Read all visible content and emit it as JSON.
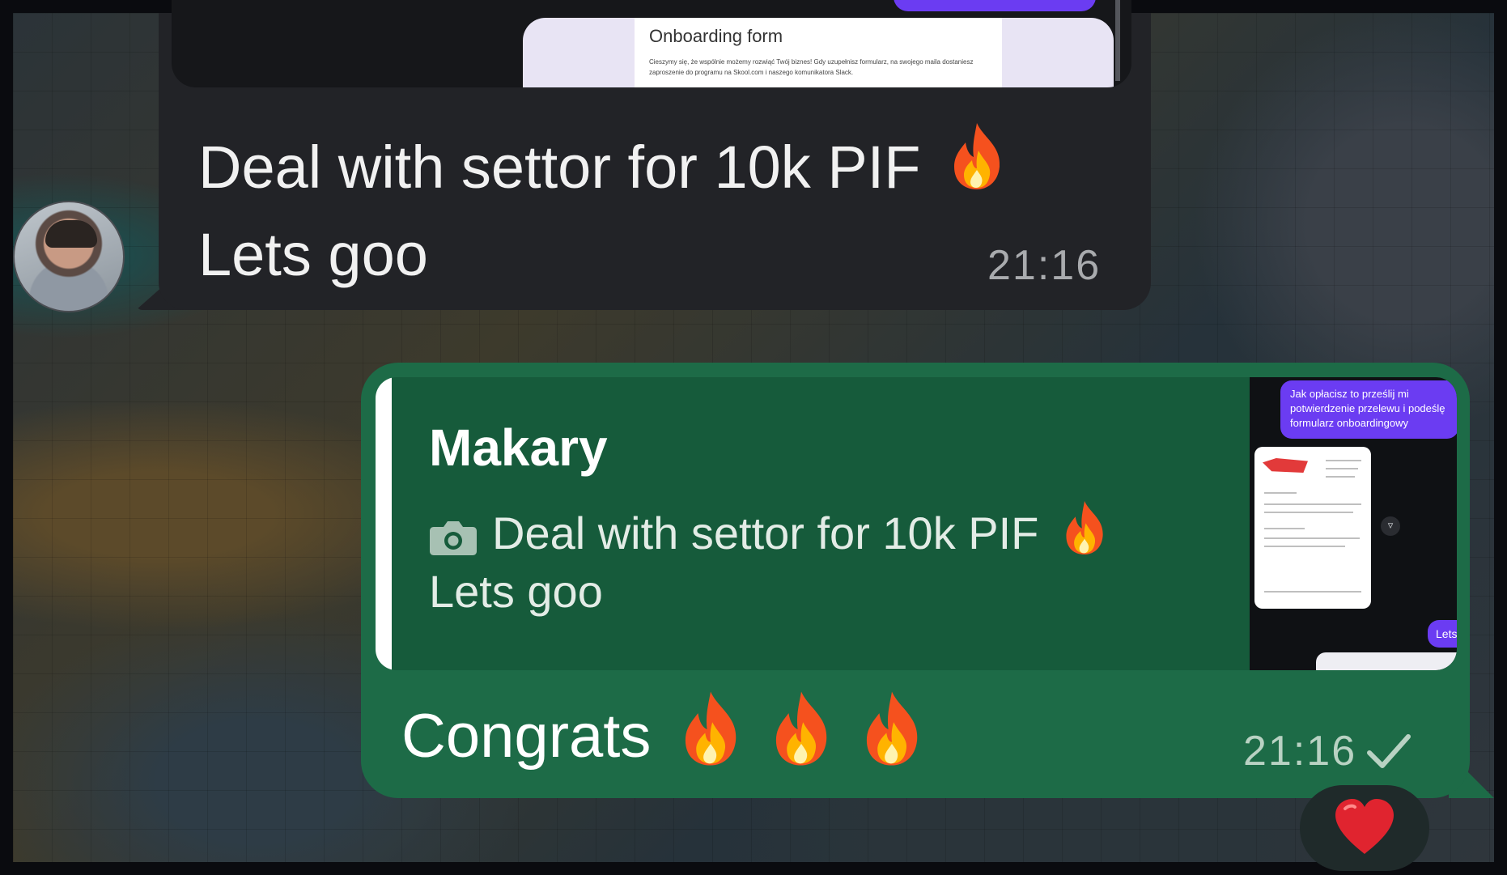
{
  "incoming": {
    "doc_title": "Onboarding form",
    "doc_body": "Cieszymy się, że wspólnie możemy rozwiąć Twój biznes! Gdy uzupełnisz formularz, na swojego maila dostaniesz zaproszenie do programu na Skool.com i naszego komunikatora Slack.",
    "text_line1": "Deal with settor for 10k PIF",
    "text_line2": "Lets goo",
    "time": "21:16",
    "emoji_icon": "fire-icon"
  },
  "outgoing": {
    "reply": {
      "name": "Makary",
      "line1": "Deal with settor for 10k PIF",
      "line2": "Lets goo",
      "media_icon": "camera-icon"
    },
    "thumbnail": {
      "bubble_text": "Jak opłacisz to prześlij mi potwierdzenie przelewu i podeślę formularz onboardingowy",
      "lets_text": "Lets"
    },
    "text": "Congrats",
    "fire_count": 3,
    "time": "21:16",
    "status_icon": "check-icon"
  },
  "reaction": {
    "icon": "heart-icon"
  },
  "colors": {
    "incoming_bubble": "#222327",
    "outgoing_bubble": "#1d6b47",
    "reply_box": "#165b3b",
    "accent_purple": "#6b3cf2",
    "heart": "#e0242f"
  }
}
